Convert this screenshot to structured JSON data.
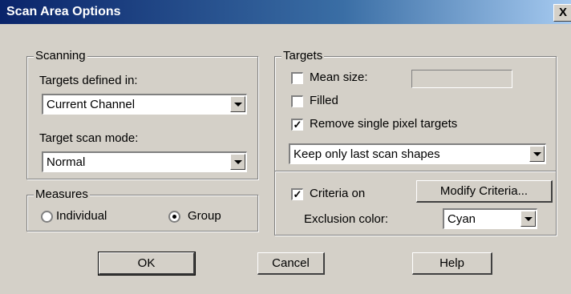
{
  "window": {
    "title": "Scan Area Options",
    "close_glyph": "X"
  },
  "scanning": {
    "legend": "Scanning",
    "targets_defined_label": "Targets defined in:",
    "targets_defined_value": "Current Channel",
    "scan_mode_label": "Target scan mode:",
    "scan_mode_value": "Normal"
  },
  "measures": {
    "legend": "Measures",
    "individual_label": "Individual",
    "group_label": "Group",
    "selected": "Group"
  },
  "targets": {
    "legend": "Targets",
    "mean_size_label": "Mean size:",
    "mean_size_checked": false,
    "mean_size_value": "",
    "filled_label": "Filled",
    "filled_checked": false,
    "remove_single_label": "Remove single pixel targets",
    "remove_single_checked": true,
    "check_glyph": "✓",
    "keep_shapes_value": "Keep only last scan shapes",
    "criteria_label": "Criteria on",
    "criteria_checked": true,
    "modify_criteria_label": "Modify Criteria...",
    "exclusion_label": "Exclusion color:",
    "exclusion_value": "Cyan"
  },
  "buttons": {
    "ok": "OK",
    "cancel": "Cancel",
    "help": "Help"
  }
}
